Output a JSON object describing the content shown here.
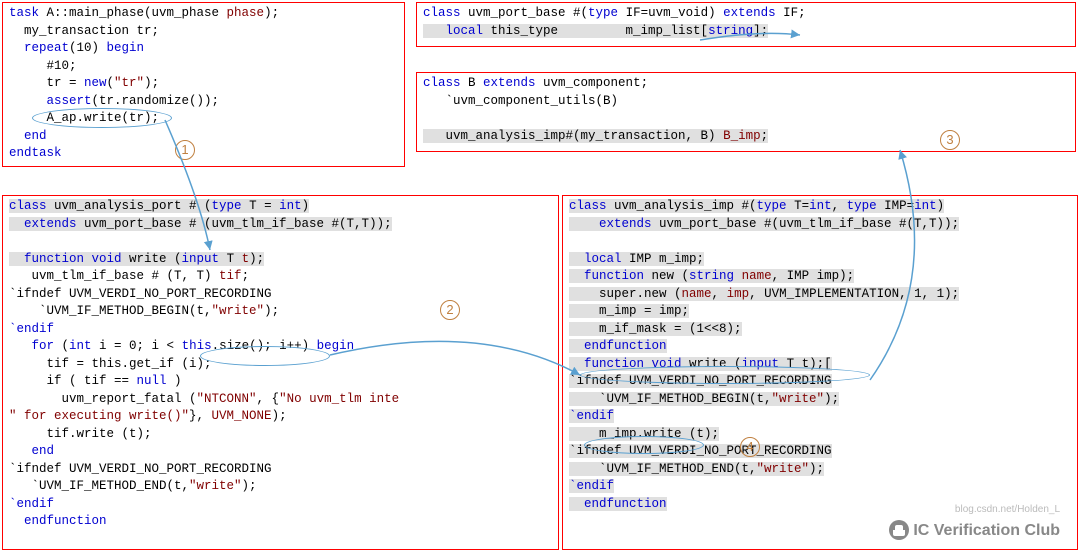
{
  "box1": {
    "l1a": "task",
    "l1b": " A::main_phase(uvm_phase ",
    "l1c": "phase",
    "l1d": ");",
    "l2": "  my_transaction tr;",
    "l3a": "  repeat",
    "l3b": "(10) ",
    "l3c": "begin",
    "l4": "     #10;",
    "l5a": "     tr = ",
    "l5b": "new",
    "l5c": "(",
    "l5d": "\"tr\"",
    "l5e": ");",
    "l6a": "     ",
    "l6b": "assert",
    "l6c": "(tr.randomize());",
    "l7": "     A_ap.write(tr);",
    "l8": "  end",
    "l9": "endtask"
  },
  "box2": {
    "l1a": "class",
    "l1b": " uvm_port_base #(",
    "l1c": "type",
    "l1d": " IF=uvm_void) ",
    "l1e": "extends",
    "l1f": " IF;",
    "l2a": "   local",
    "l2b": " this_type         m_imp_list[",
    "l2c": "string",
    "l2d": "];"
  },
  "box3": {
    "l1a": "class",
    "l1b": " B ",
    "l1c": "extends",
    "l1d": " uvm_component;",
    "l2": "   `uvm_component_utils(B)",
    "l3": "",
    "l4a": "   uvm_analysis_imp#(my_transaction, B) ",
    "l4b": "B_imp",
    "l4c": ";"
  },
  "box4": {
    "l1a": "class",
    "l1b": " uvm_analysis_port # (",
    "l1c": "type",
    "l1d": " T = ",
    "l1e": "int",
    "l1f": ")",
    "l2a": "  extends",
    "l2b": " uvm_port_base # (uvm_tlm_if_base #(T,T));",
    "l3": "",
    "l4a": "  function void",
    "l4b": " write (",
    "l4c": "input",
    "l4d": " T ",
    "l4e": "t",
    "l4f": ");",
    "l5a": "   uvm_tlm_if_base # (T, T) ",
    "l5b": "tif",
    "l5c": ";",
    "l6": "`ifndef UVM_VERDI_NO_PORT_RECORDING",
    "l7a": "    `UVM_IF_METHOD_BEGIN(t,",
    "l7b": "\"write\"",
    "l7c": ");",
    "l8": "`endif",
    "l9a": "   for",
    "l9b": " (",
    "l9c": "int",
    "l9d": " i = 0; i < ",
    "l9e": "this",
    "l9f": ".size(); i++) ",
    "l9g": "begin",
    "l10": "     tif = this.get_if (i);",
    "l11a": "     if ( tif == ",
    "l11b": "null",
    "l11c": " )",
    "l12a": "       uvm_report_fatal (",
    "l12b": "\"NTCONN\"",
    "l12c": ", {",
    "l12d": "\"No uvm_tlm inte",
    "l12e": "",
    "l13a": "\" for executing write()\"",
    "l13b": "}, ",
    "l13c": "UVM_NONE",
    "l13d": ");",
    "l14": "     tif.write (t);",
    "l15": "   end",
    "l16": "`ifndef UVM_VERDI_NO_PORT_RECORDING",
    "l17a": "   `UVM_IF_METHOD_END(t,",
    "l17b": "\"write\"",
    "l17c": ");",
    "l18": "`endif",
    "l19": "  endfunction"
  },
  "box5": {
    "l1a": "class",
    "l1b": " uvm_analysis_imp #(",
    "l1c": "type",
    "l1d": " T=",
    "l1e": "int",
    "l1f": ", ",
    "l1g": "type",
    "l1h": " IMP=",
    "l1i": "int",
    "l1j": ")",
    "l2a": "    extends",
    "l2b": " uvm_port_base #(uvm_tlm_if_base #(T,T));",
    "l3": "",
    "l4a": "  local",
    "l4b": " IMP m_imp;",
    "l5a": "  function",
    "l5b": " new (",
    "l5c": "string",
    "l5d": " ",
    "l5e": "name",
    "l5f": ", IMP imp);",
    "l6a": "    super.new (",
    "l6b": "name",
    "l6c": ", ",
    "l6d": "imp",
    "l6e": ", UVM_IMPLEMENTATION, 1, 1);",
    "l7": "    m_imp = imp;",
    "l8": "    m_if_mask = (1<<8);",
    "l9": "  endfunction",
    "l10a": "  function void",
    "l10b": " write (",
    "l10c": "input",
    "l10d": " T t);[",
    "l11": "`ifndef UVM_VERDI_NO_PORT_RECORDING",
    "l12a": "    `UVM_IF_METHOD_BEGIN(t,",
    "l12b": "\"write\"",
    "l12c": ");",
    "l13": "`endif",
    "l14": "    m_imp.write (t);",
    "l15": "`ifndef UVM_VERDI_NO_PORT_RECORDING",
    "l16a": "    `UVM_IF_METHOD_END(t,",
    "l16b": "\"write\"",
    "l16c": ");",
    "l17": "`endif",
    "l18": "  endfunction"
  },
  "labels": {
    "c1": "1",
    "c2": "2",
    "c3": "3",
    "c4": "4"
  },
  "watermark": "IC Verification Club",
  "watermark2": "blog.csdn.net/Holden_L"
}
